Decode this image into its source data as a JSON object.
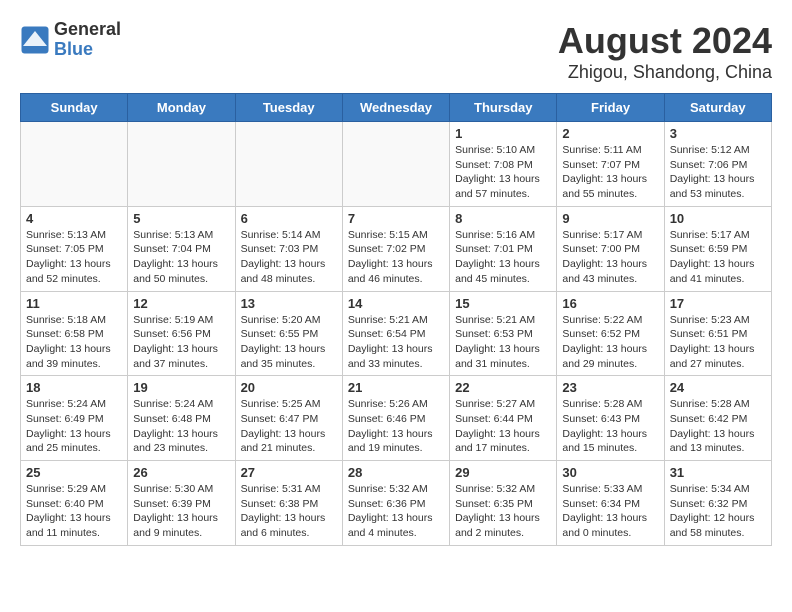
{
  "header": {
    "logo_general": "General",
    "logo_blue": "Blue",
    "title": "August 2024",
    "subtitle": "Zhigou, Shandong, China"
  },
  "weekdays": [
    "Sunday",
    "Monday",
    "Tuesday",
    "Wednesday",
    "Thursday",
    "Friday",
    "Saturday"
  ],
  "weeks": [
    [
      {
        "day": "",
        "info": ""
      },
      {
        "day": "",
        "info": ""
      },
      {
        "day": "",
        "info": ""
      },
      {
        "day": "",
        "info": ""
      },
      {
        "day": "1",
        "info": "Sunrise: 5:10 AM\nSunset: 7:08 PM\nDaylight: 13 hours\nand 57 minutes."
      },
      {
        "day": "2",
        "info": "Sunrise: 5:11 AM\nSunset: 7:07 PM\nDaylight: 13 hours\nand 55 minutes."
      },
      {
        "day": "3",
        "info": "Sunrise: 5:12 AM\nSunset: 7:06 PM\nDaylight: 13 hours\nand 53 minutes."
      }
    ],
    [
      {
        "day": "4",
        "info": "Sunrise: 5:13 AM\nSunset: 7:05 PM\nDaylight: 13 hours\nand 52 minutes."
      },
      {
        "day": "5",
        "info": "Sunrise: 5:13 AM\nSunset: 7:04 PM\nDaylight: 13 hours\nand 50 minutes."
      },
      {
        "day": "6",
        "info": "Sunrise: 5:14 AM\nSunset: 7:03 PM\nDaylight: 13 hours\nand 48 minutes."
      },
      {
        "day": "7",
        "info": "Sunrise: 5:15 AM\nSunset: 7:02 PM\nDaylight: 13 hours\nand 46 minutes."
      },
      {
        "day": "8",
        "info": "Sunrise: 5:16 AM\nSunset: 7:01 PM\nDaylight: 13 hours\nand 45 minutes."
      },
      {
        "day": "9",
        "info": "Sunrise: 5:17 AM\nSunset: 7:00 PM\nDaylight: 13 hours\nand 43 minutes."
      },
      {
        "day": "10",
        "info": "Sunrise: 5:17 AM\nSunset: 6:59 PM\nDaylight: 13 hours\nand 41 minutes."
      }
    ],
    [
      {
        "day": "11",
        "info": "Sunrise: 5:18 AM\nSunset: 6:58 PM\nDaylight: 13 hours\nand 39 minutes."
      },
      {
        "day": "12",
        "info": "Sunrise: 5:19 AM\nSunset: 6:56 PM\nDaylight: 13 hours\nand 37 minutes."
      },
      {
        "day": "13",
        "info": "Sunrise: 5:20 AM\nSunset: 6:55 PM\nDaylight: 13 hours\nand 35 minutes."
      },
      {
        "day": "14",
        "info": "Sunrise: 5:21 AM\nSunset: 6:54 PM\nDaylight: 13 hours\nand 33 minutes."
      },
      {
        "day": "15",
        "info": "Sunrise: 5:21 AM\nSunset: 6:53 PM\nDaylight: 13 hours\nand 31 minutes."
      },
      {
        "day": "16",
        "info": "Sunrise: 5:22 AM\nSunset: 6:52 PM\nDaylight: 13 hours\nand 29 minutes."
      },
      {
        "day": "17",
        "info": "Sunrise: 5:23 AM\nSunset: 6:51 PM\nDaylight: 13 hours\nand 27 minutes."
      }
    ],
    [
      {
        "day": "18",
        "info": "Sunrise: 5:24 AM\nSunset: 6:49 PM\nDaylight: 13 hours\nand 25 minutes."
      },
      {
        "day": "19",
        "info": "Sunrise: 5:24 AM\nSunset: 6:48 PM\nDaylight: 13 hours\nand 23 minutes."
      },
      {
        "day": "20",
        "info": "Sunrise: 5:25 AM\nSunset: 6:47 PM\nDaylight: 13 hours\nand 21 minutes."
      },
      {
        "day": "21",
        "info": "Sunrise: 5:26 AM\nSunset: 6:46 PM\nDaylight: 13 hours\nand 19 minutes."
      },
      {
        "day": "22",
        "info": "Sunrise: 5:27 AM\nSunset: 6:44 PM\nDaylight: 13 hours\nand 17 minutes."
      },
      {
        "day": "23",
        "info": "Sunrise: 5:28 AM\nSunset: 6:43 PM\nDaylight: 13 hours\nand 15 minutes."
      },
      {
        "day": "24",
        "info": "Sunrise: 5:28 AM\nSunset: 6:42 PM\nDaylight: 13 hours\nand 13 minutes."
      }
    ],
    [
      {
        "day": "25",
        "info": "Sunrise: 5:29 AM\nSunset: 6:40 PM\nDaylight: 13 hours\nand 11 minutes."
      },
      {
        "day": "26",
        "info": "Sunrise: 5:30 AM\nSunset: 6:39 PM\nDaylight: 13 hours\nand 9 minutes."
      },
      {
        "day": "27",
        "info": "Sunrise: 5:31 AM\nSunset: 6:38 PM\nDaylight: 13 hours\nand 6 minutes."
      },
      {
        "day": "28",
        "info": "Sunrise: 5:32 AM\nSunset: 6:36 PM\nDaylight: 13 hours\nand 4 minutes."
      },
      {
        "day": "29",
        "info": "Sunrise: 5:32 AM\nSunset: 6:35 PM\nDaylight: 13 hours\nand 2 minutes."
      },
      {
        "day": "30",
        "info": "Sunrise: 5:33 AM\nSunset: 6:34 PM\nDaylight: 13 hours\nand 0 minutes."
      },
      {
        "day": "31",
        "info": "Sunrise: 5:34 AM\nSunset: 6:32 PM\nDaylight: 12 hours\nand 58 minutes."
      }
    ]
  ]
}
